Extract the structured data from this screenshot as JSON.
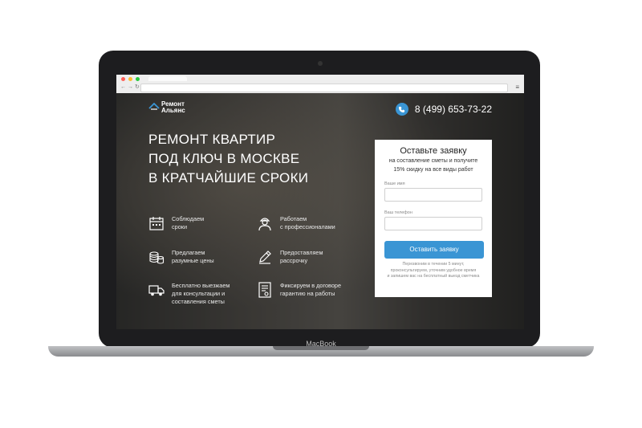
{
  "device": {
    "brand": "MacBook"
  },
  "site": {
    "logo": {
      "line1": "Ремонт",
      "line2": "Альянс"
    },
    "phone": "8 (499) 653-73-22",
    "headline": [
      "РЕМОНТ КВАРТИР",
      "ПОД КЛЮЧ В МОСКВЕ",
      "В КРАТЧАЙШИЕ СРОКИ"
    ],
    "features": [
      {
        "icon": "calendar-icon",
        "lines": [
          "Соблюдаем",
          "сроки"
        ]
      },
      {
        "icon": "worker-icon",
        "lines": [
          "Работаем",
          "с профессионалами"
        ]
      },
      {
        "icon": "coins-icon",
        "lines": [
          "Предлагаем",
          "разумные цены"
        ]
      },
      {
        "icon": "pen-icon",
        "lines": [
          "Предоставляем",
          "рассрочку"
        ]
      },
      {
        "icon": "truck-icon",
        "lines": [
          "Бесплатно выезжаем",
          "для консультации и",
          "составления сметы"
        ]
      },
      {
        "icon": "document-icon",
        "lines": [
          "Фиксируем в договоре",
          "гарантию на работы"
        ]
      }
    ],
    "form": {
      "title": "Оставьте заявку",
      "subtitle_line1": "на составление сметы и получите",
      "subtitle_line2": "15% скидку на все виды работ",
      "name_label": "Ваше имя",
      "name_value": "",
      "phone_label": "Ваш телефон",
      "phone_value": "",
      "submit_label": "Оставить заявку",
      "note_line1": "Перезвоним в течении 5 минут,",
      "note_line2": "проконсультируем, уточним удобное время",
      "note_line3": "и запишем вас на бесплатный выезд сметчика"
    },
    "accent_color": "#3a95d4"
  }
}
